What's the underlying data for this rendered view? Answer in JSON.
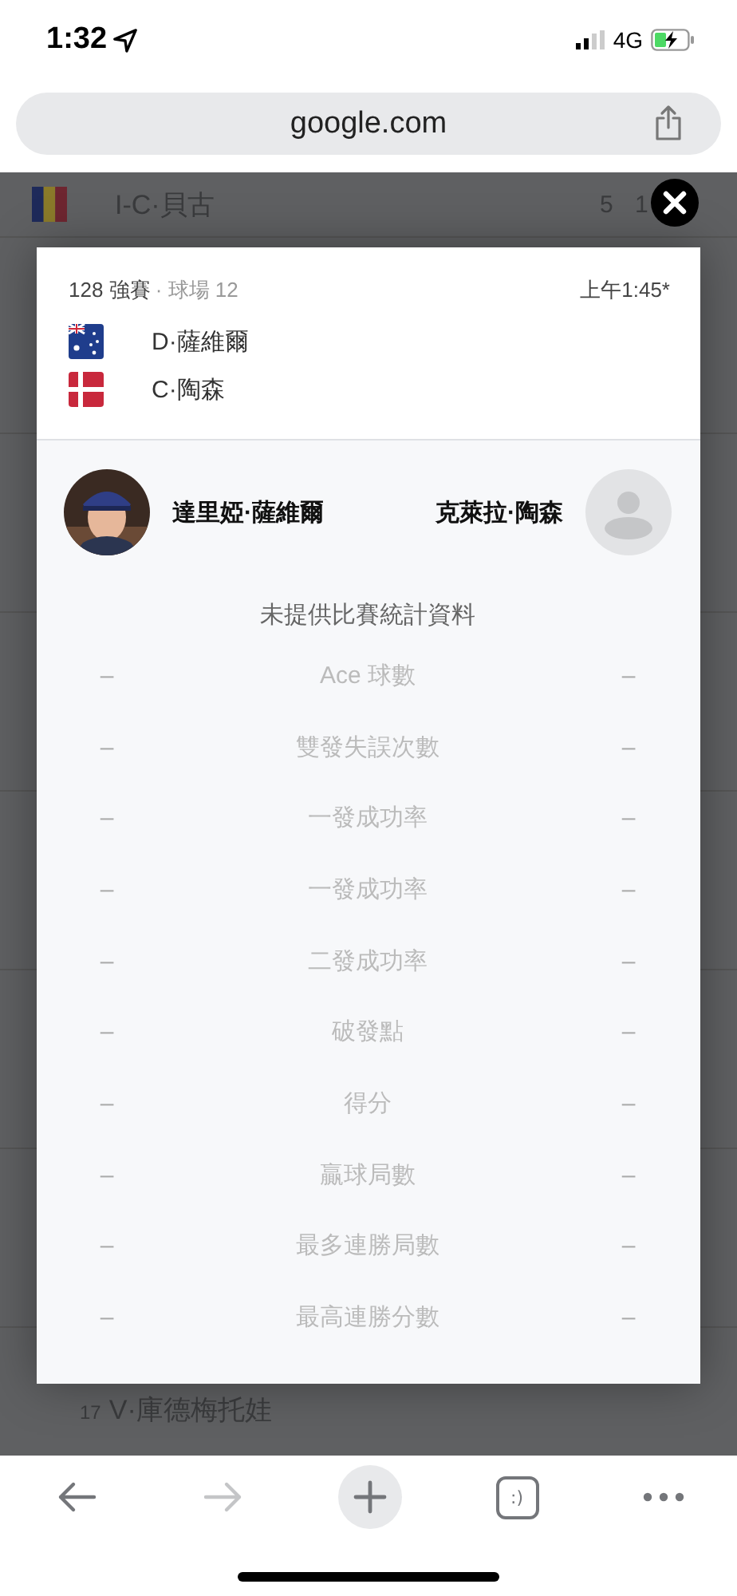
{
  "status_bar": {
    "time": "1:32",
    "network": "4G"
  },
  "browser": {
    "url": "google.com"
  },
  "background": {
    "top_row": {
      "name": "I-C·貝古",
      "score_1": "5",
      "score_2": "1"
    },
    "bottom_row": {
      "seed": "17",
      "name": "V·庫德梅托娃"
    }
  },
  "match": {
    "round": "128 強賽",
    "court": "· 球場 12",
    "time": "上午1:45*",
    "players": [
      {
        "name": "D·薩維爾",
        "flag": {
          "kind": "australia"
        }
      },
      {
        "name": "C·陶森",
        "flag": {
          "kind": "denmark"
        }
      }
    ]
  },
  "stats": {
    "players": [
      {
        "name": "達里婭·薩維爾"
      },
      {
        "name": "克萊拉·陶森",
        "avatar": {
          "kind": "placeholder"
        }
      }
    ],
    "message": "未提供比賽統計資料",
    "rows": [
      {
        "label": "Ace 球數",
        "left": "–",
        "right": "–"
      },
      {
        "label": "雙發失誤次數",
        "left": "–",
        "right": "–"
      },
      {
        "label": "一發成功率",
        "left": "–",
        "right": "–"
      },
      {
        "label": "一發成功率",
        "left": "–",
        "right": "–"
      },
      {
        "label": "二發成功率",
        "left": "–",
        "right": "–"
      },
      {
        "label": "破發點",
        "left": "–",
        "right": "–"
      },
      {
        "label": "得分",
        "left": "–",
        "right": "–"
      },
      {
        "label": "贏球局數",
        "left": "–",
        "right": "–"
      },
      {
        "label": "最多連勝局數",
        "left": "–",
        "right": "–"
      },
      {
        "label": "最高連勝分數",
        "left": "–",
        "right": "–"
      }
    ]
  },
  "toolbar": {
    "buttons": [
      {
        "kind": "back",
        "disabled": false
      },
      {
        "kind": "forward",
        "disabled": true
      },
      {
        "kind": "new_tab",
        "disabled": false
      },
      {
        "kind": "tabs",
        "label": ":)",
        "disabled": false
      },
      {
        "kind": "more",
        "disabled": false
      }
    ]
  }
}
